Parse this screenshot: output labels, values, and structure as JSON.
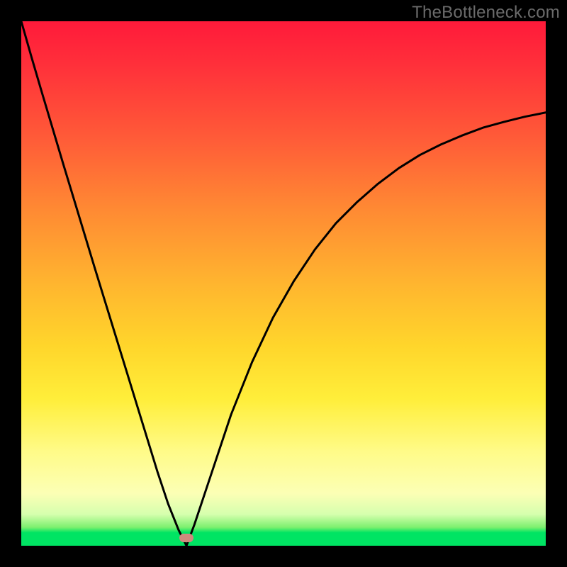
{
  "watermark": "TheBottleneck.com",
  "colors": {
    "curve": "#000000",
    "marker": "#cf8a7d",
    "frame": "#000000"
  },
  "chart_data": {
    "type": "line",
    "title": "",
    "xlabel": "",
    "ylabel": "",
    "xlim": [
      0,
      1
    ],
    "ylim": [
      0,
      1
    ],
    "annotations": [
      {
        "type": "marker",
        "x": 0.315,
        "y": 0.015
      }
    ],
    "series": [
      {
        "name": "bottleneck-curve",
        "x": [
          0.0,
          0.02,
          0.04,
          0.06,
          0.08,
          0.1,
          0.12,
          0.14,
          0.16,
          0.18,
          0.2,
          0.22,
          0.24,
          0.26,
          0.28,
          0.3,
          0.315,
          0.33,
          0.36,
          0.4,
          0.44,
          0.48,
          0.52,
          0.56,
          0.6,
          0.64,
          0.68,
          0.72,
          0.76,
          0.8,
          0.84,
          0.88,
          0.92,
          0.96,
          1.0
        ],
        "y": [
          1.0,
          0.93,
          0.862,
          0.795,
          0.728,
          0.662,
          0.596,
          0.53,
          0.465,
          0.4,
          0.335,
          0.27,
          0.205,
          0.14,
          0.08,
          0.03,
          0.0,
          0.04,
          0.13,
          0.25,
          0.35,
          0.435,
          0.505,
          0.565,
          0.615,
          0.655,
          0.69,
          0.72,
          0.745,
          0.765,
          0.782,
          0.797,
          0.808,
          0.818,
          0.826
        ]
      }
    ]
  }
}
